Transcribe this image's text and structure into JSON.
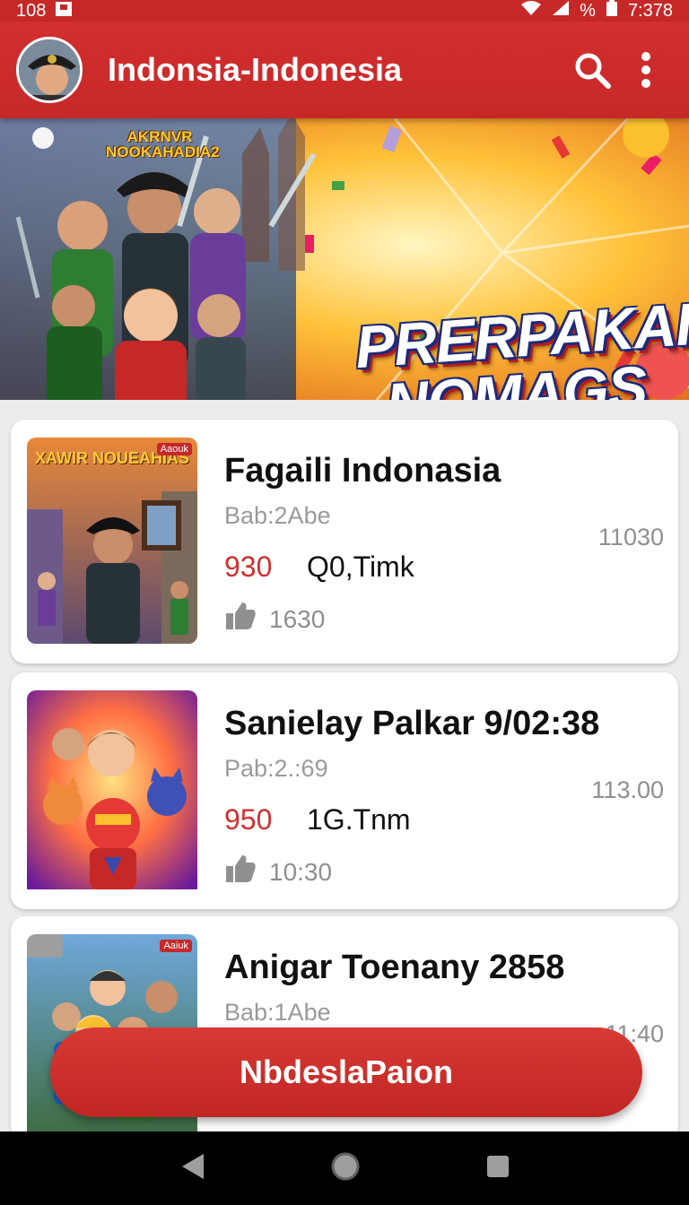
{
  "status_bar": {
    "left_text": "108",
    "battery_text": "%",
    "time": "7:378"
  },
  "app_bar": {
    "title": "Indonsia-Indonesia",
    "avatar": "avatar-icon",
    "search_icon": "search-icon",
    "menu_icon": "more-vert-icon"
  },
  "banner": {
    "logo_text": "AKRNVR NOOKAHADIA2",
    "headline_line1": "PRERPAKAI",
    "headline_line2": "NOMAGS"
  },
  "cards": [
    {
      "thumb_label": "XAWIR NOUEAHIAS",
      "thumb_badge": "Aaouk",
      "title": "Fagaili Indonasia",
      "subtitle": "Bab:2Abe",
      "side": "11030",
      "price": "930",
      "meta": "Q0,Timk",
      "likes": "1630"
    },
    {
      "thumb_label": "",
      "thumb_badge": "",
      "title": "Sanielay Palkar 9/02:38",
      "subtitle": "Pab:2.:69",
      "side": "113.00",
      "price": "950",
      "meta": "1G.Tnm",
      "likes": "10:30"
    },
    {
      "thumb_label": "",
      "thumb_badge": "Aaiuk",
      "title": "Anigar Toenany 2858",
      "subtitle": "Bab:1Abe",
      "side": "11:40",
      "price": "",
      "meta": "",
      "likes": ""
    }
  ],
  "fab": {
    "label": "NbdeslaPaion"
  },
  "colors": {
    "primary": "#c62828",
    "price": "#d32f2f",
    "muted": "#9a9a9a"
  }
}
